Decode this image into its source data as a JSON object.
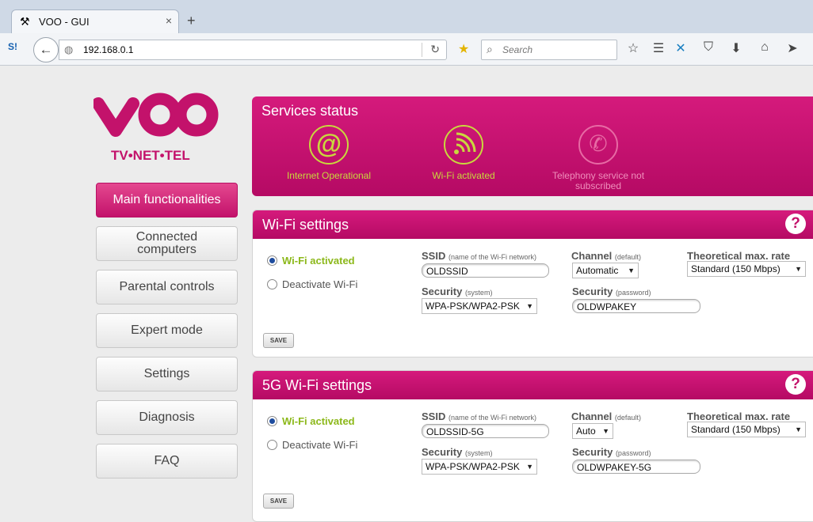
{
  "browser": {
    "tab_title": "VOO - GUI",
    "new_tab": "+",
    "close": "×",
    "url": "192.168.0.1",
    "search_placeholder": "Search"
  },
  "logo": {
    "brand": "VOO",
    "tagline": "TV•NET•TEL",
    "color": "#c3126b"
  },
  "sidebar": {
    "items": [
      {
        "label": "Main functionalities",
        "active": true
      },
      {
        "label": "Connected computers",
        "active": false
      },
      {
        "label": "Parental controls",
        "active": false
      },
      {
        "label": "Expert mode",
        "active": false
      },
      {
        "label": "Settings",
        "active": false
      },
      {
        "label": "Diagnosis",
        "active": false
      },
      {
        "label": "FAQ",
        "active": false
      }
    ]
  },
  "services": {
    "title": "Services status",
    "items": [
      {
        "label": "Internet Operational",
        "icon": "at-icon",
        "active": true
      },
      {
        "label": "Wi-Fi activated",
        "icon": "wifi-icon",
        "active": true
      },
      {
        "label": "Telephony service not subscribed",
        "icon": "phone-icon",
        "active": false
      }
    ]
  },
  "wifi": {
    "title": "Wi-Fi settings",
    "help": "?",
    "radio_on": "Wi-Fi activated",
    "radio_off": "Deactivate Wi-Fi",
    "ssid_label": "SSID",
    "ssid_hint": "(name of the Wi-Fi network)",
    "ssid_value": "OLDSSID",
    "channel_label": "Channel",
    "channel_hint": "(default)",
    "channel_value": "Automatic",
    "rate_label": "Theoretical max. rate",
    "rate_value": "Standard (150 Mbps)",
    "security_label": "Security",
    "security_hint": "(system)",
    "security_value": "WPA-PSK/WPA2-PSK",
    "password_label": "Security",
    "password_hint": "(password)",
    "password_value": "OLDWPAKEY",
    "save": "SAVE"
  },
  "wifi5g": {
    "title": "5G Wi-Fi settings",
    "help": "?",
    "radio_on": "Wi-Fi activated",
    "radio_off": "Deactivate Wi-Fi",
    "ssid_label": "SSID",
    "ssid_hint": "(name of the Wi-Fi network)",
    "ssid_value": "OLDSSID-5G",
    "channel_label": "Channel",
    "channel_hint": "(default)",
    "channel_value": "Auto",
    "rate_label": "Theoretical max. rate",
    "rate_value": "Standard (150 Mbps)",
    "security_label": "Security",
    "security_hint": "(system)",
    "security_value": "WPA-PSK/WPA2-PSK",
    "password_label": "Security",
    "password_hint": "(password)",
    "password_value": "OLDWPAKEY-5G",
    "save": "SAVE"
  }
}
